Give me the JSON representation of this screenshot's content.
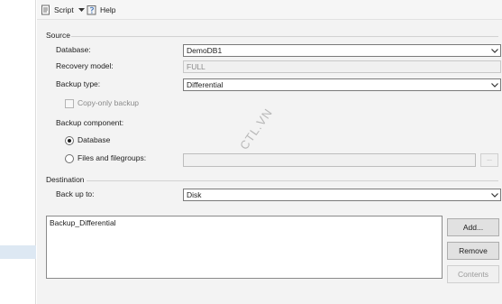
{
  "toolbar": {
    "script_label": "Script",
    "script_icon": "script-icon",
    "dropdown_icon": "chevron-down-icon",
    "help_label": "Help",
    "help_icon": "help-icon"
  },
  "source": {
    "section_title": "Source",
    "database_label": "Database:",
    "database_value": "DemoDB1",
    "recovery_model_label": "Recovery model:",
    "recovery_model_value": "FULL",
    "backup_type_label": "Backup type:",
    "backup_type_value": "Differential",
    "copy_only_label": "Copy-only backup",
    "backup_component_label": "Backup component:",
    "component_database_label": "Database",
    "component_files_label": "Files and filegroups:",
    "browse_label": "..."
  },
  "destination": {
    "section_title": "Destination",
    "back_up_to_label": "Back up to:",
    "back_up_to_value": "Disk",
    "list_items": [
      "Backup_Differential"
    ],
    "add_label": "Add...",
    "remove_label": "Remove",
    "contents_label": "Contents"
  },
  "watermark": "CTL.VN",
  "colors": {
    "panel_bg": "#f3f3f3",
    "selection_bg": "#dde8f3",
    "border": "#7a7a7a",
    "disabled_text": "#8a8a8a"
  }
}
